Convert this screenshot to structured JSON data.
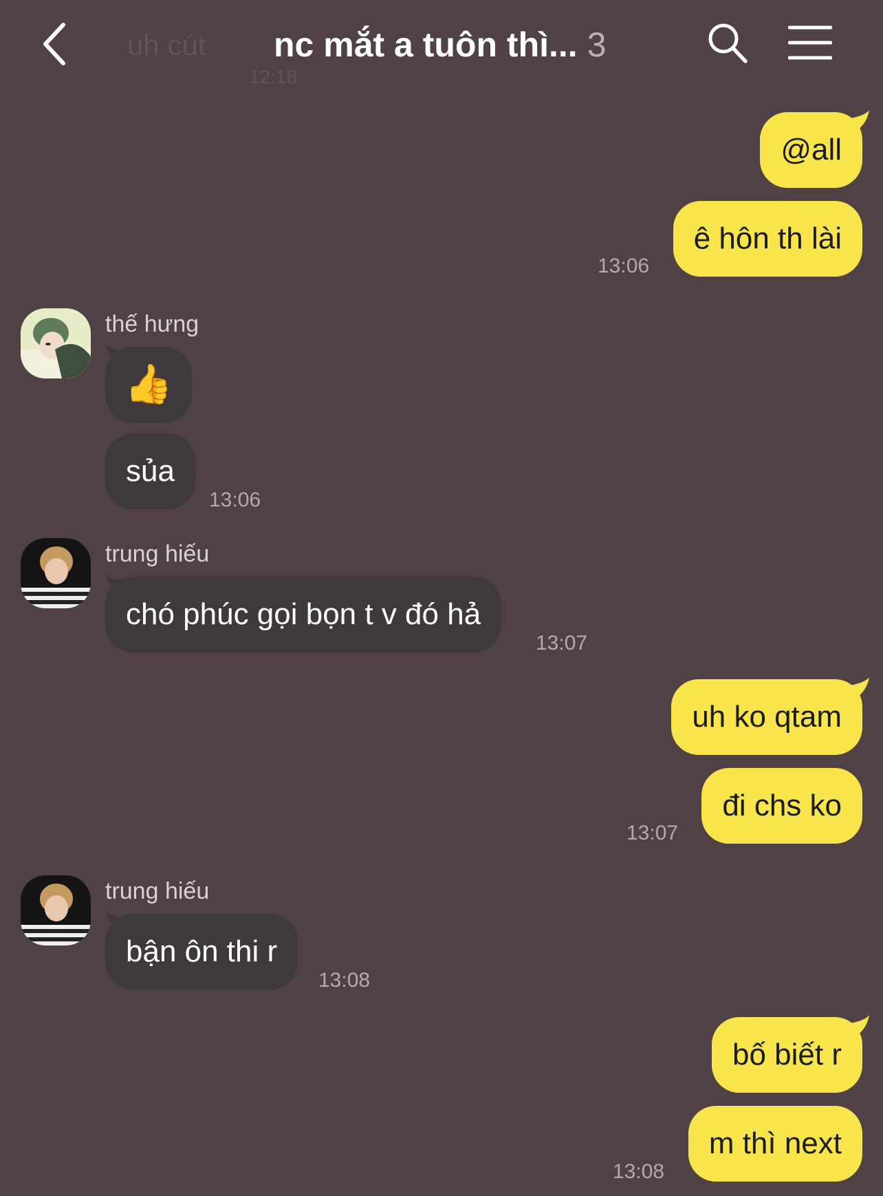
{
  "header": {
    "back_icon": "chevron-left-icon",
    "faded_preview": "uh cút",
    "faded_time": "12:18",
    "title": "nc mắt a tuôn thì...",
    "member_count": "3",
    "search_icon": "search-icon",
    "menu_icon": "hamburger-menu-icon"
  },
  "messages": [
    {
      "text": "@all",
      "from": "me"
    },
    {
      "text": "ê hôn th lài",
      "from": "me",
      "time": "13:06"
    },
    {
      "sender": "thế hưng",
      "text": "👍",
      "from": "other"
    },
    {
      "text": "sủa",
      "from": "other",
      "time": "13:06"
    },
    {
      "sender": "trung hiếu",
      "text": "chó phúc gọi bọn t v đó hả",
      "from": "other",
      "time": "13:07"
    },
    {
      "text": "uh ko qtam",
      "from": "me"
    },
    {
      "text": "đi chs ko",
      "from": "me",
      "time": "13:07"
    },
    {
      "sender": "trung hiếu",
      "text": "bận ôn thi r",
      "from": "other",
      "time": "13:08"
    },
    {
      "text": "bố biết r",
      "from": "me"
    },
    {
      "text": "m thì next",
      "from": "me",
      "time": "13:08"
    }
  ],
  "colors": {
    "background": "#4f4144",
    "my_bubble": "#f8e54c",
    "other_bubble": "#3e3a3b"
  }
}
